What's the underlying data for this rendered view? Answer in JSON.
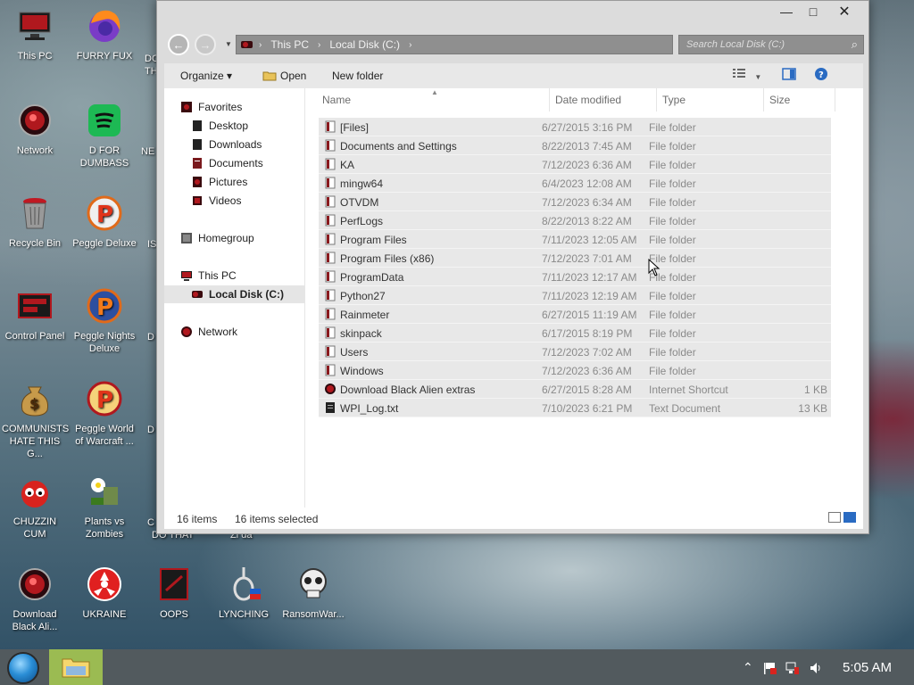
{
  "desktop": {
    "icons": [
      {
        "label": "This PC"
      },
      {
        "label": "FURRY FUX"
      },
      {
        "label": "Network"
      },
      {
        "label": "D FOR DUMBASS"
      },
      {
        "label": "Recycle Bin"
      },
      {
        "label": "Peggle Deluxe"
      },
      {
        "label": "Control Panel"
      },
      {
        "label": "Peggle Nights Deluxe"
      },
      {
        "label": "COMMUNISTS HATE THIS G..."
      },
      {
        "label": "Peggle World of Warcraft ..."
      },
      {
        "label": "CHUZZIN CUM"
      },
      {
        "label": "Plants vs Zombies"
      },
      {
        "label": "Download Black Ali..."
      },
      {
        "label": "UKRAINE"
      },
      {
        "label": "OOPS"
      },
      {
        "label": "LYNCHING"
      },
      {
        "label": "RansomWar..."
      }
    ],
    "partial_labels": [
      "DC",
      "TH",
      "NE",
      "IS",
      "D",
      "D",
      "C",
      "DO THAT",
      "Zi da"
    ]
  },
  "window": {
    "controls": {
      "minimize": "—",
      "maximize": "□",
      "close": "✕"
    },
    "address": {
      "crumbs": [
        "This PC",
        "Local Disk (C:)"
      ],
      "separator": "›"
    },
    "search": {
      "placeholder": "Search Local Disk (C:)"
    },
    "commands": {
      "organize": "Organize ▾",
      "open": "Open",
      "new_folder": "New folder"
    },
    "nav": {
      "favorites": "Favorites",
      "desktop": "Desktop",
      "downloads": "Downloads",
      "documents": "Documents",
      "pictures": "Pictures",
      "videos": "Videos",
      "homegroup": "Homegroup",
      "this_pc": "This PC",
      "local_disk": "Local Disk (C:)",
      "network": "Network"
    },
    "columns": {
      "name": "Name",
      "date": "Date modified",
      "type": "Type",
      "size": "Size"
    },
    "files": [
      {
        "name": "[Files]",
        "date": "6/27/2015 3:16 PM",
        "type": "File folder",
        "size": ""
      },
      {
        "name": "Documents and Settings",
        "date": "8/22/2013 7:45 AM",
        "type": "File folder",
        "size": ""
      },
      {
        "name": "KA",
        "date": "7/12/2023 6:36 AM",
        "type": "File folder",
        "size": ""
      },
      {
        "name": "mingw64",
        "date": "6/4/2023 12:08 AM",
        "type": "File folder",
        "size": ""
      },
      {
        "name": "OTVDM",
        "date": "7/12/2023 6:34 AM",
        "type": "File folder",
        "size": ""
      },
      {
        "name": "PerfLogs",
        "date": "8/22/2013 8:22 AM",
        "type": "File folder",
        "size": ""
      },
      {
        "name": "Program Files",
        "date": "7/11/2023 12:05 AM",
        "type": "File folder",
        "size": ""
      },
      {
        "name": "Program Files (x86)",
        "date": "7/12/2023 7:01 AM",
        "type": "File folder",
        "size": ""
      },
      {
        "name": "ProgramData",
        "date": "7/11/2023 12:17 AM",
        "type": "File folder",
        "size": ""
      },
      {
        "name": "Python27",
        "date": "7/11/2023 12:19 AM",
        "type": "File folder",
        "size": ""
      },
      {
        "name": "Rainmeter",
        "date": "6/27/2015 11:19 AM",
        "type": "File folder",
        "size": ""
      },
      {
        "name": "skinpack",
        "date": "6/17/2015 8:19 PM",
        "type": "File folder",
        "size": ""
      },
      {
        "name": "Users",
        "date": "7/12/2023 7:02 AM",
        "type": "File folder",
        "size": ""
      },
      {
        "name": "Windows",
        "date": "7/12/2023 6:36 AM",
        "type": "File folder",
        "size": ""
      },
      {
        "name": "Download Black Alien extras",
        "date": "6/27/2015 8:28 AM",
        "type": "Internet Shortcut",
        "size": "1 KB"
      },
      {
        "name": "WPI_Log.txt",
        "date": "7/10/2023 6:21 PM",
        "type": "Text Document",
        "size": "13 KB"
      }
    ],
    "status": {
      "count": "16 items",
      "selected": "16 items selected"
    }
  },
  "taskbar": {
    "clock": "5:05 AM",
    "tray_icons": [
      "chevron-up-icon",
      "flag-icon",
      "network-icon",
      "volume-icon"
    ]
  },
  "colors": {
    "accent": "#9bbb52",
    "selection": "#e8e8e8",
    "taskbar": "#525a5e"
  }
}
